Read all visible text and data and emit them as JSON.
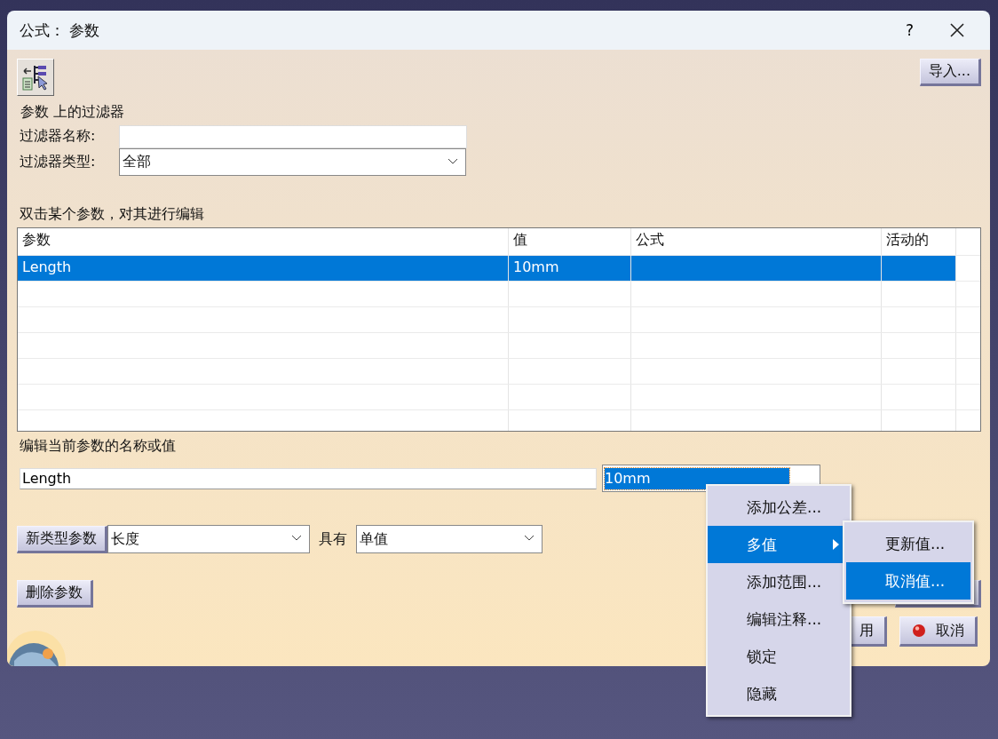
{
  "window": {
    "title": "公式： 参数",
    "help": "?"
  },
  "toolbar": {
    "import_button": "导入..."
  },
  "filter": {
    "heading": "参数 上的过滤器",
    "name_label": "过滤器名称:",
    "type_label": "过滤器类型:",
    "type_value": "全部"
  },
  "table": {
    "hint": "双击某个参数，对其进行编辑",
    "columns": [
      "参数",
      "值",
      "公式",
      "活动的"
    ],
    "rows": [
      {
        "parameter": "Length",
        "value": "10mm",
        "selected": true
      }
    ]
  },
  "editor": {
    "label": "编辑当前参数的名称或值",
    "name_value": "Length",
    "value": "10mm",
    "value_highlighted": true
  },
  "new_param": {
    "button": "新类型参数",
    "type_value": "长度",
    "with_label": "具有",
    "multiplicity_value": "单值"
  },
  "buttons": {
    "delete_param": "删除参数",
    "apply": "用",
    "cancel": "取消"
  },
  "context_menu": [
    {
      "label": "添加公差...",
      "selected": false,
      "has_submenu": false
    },
    {
      "label": "多值",
      "selected": true,
      "has_submenu": true
    },
    {
      "label": "添加范围...",
      "selected": false,
      "has_submenu": false
    },
    {
      "label": "编辑注释...",
      "selected": false,
      "has_submenu": false
    },
    {
      "label": "锁定",
      "selected": false,
      "has_submenu": false
    },
    {
      "label": "隐藏",
      "selected": false,
      "has_submenu": false
    }
  ],
  "submenu": [
    {
      "label": "更新值...",
      "selected": false
    },
    {
      "label": "取消值...",
      "selected": true
    }
  ]
}
